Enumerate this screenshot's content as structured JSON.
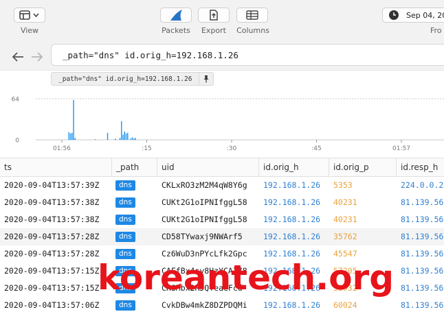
{
  "toolbar": {
    "view_label": "View",
    "packets_label": "Packets",
    "export_label": "Export",
    "columns_label": "Columns",
    "date_text": "Sep 04, 20",
    "from_label": "Fro"
  },
  "search": {
    "query": "_path=\"dns\" id.orig_h=192.168.1.26",
    "pill_text": "_path=\"dns\" id.orig_h=192.168.1.26"
  },
  "chart_data": {
    "type": "bar",
    "ylim": [
      0,
      64
    ],
    "y_ticks": [
      "64",
      "0"
    ],
    "x_ticks": [
      "01:56",
      ":15",
      ":30",
      ":45",
      "01:57"
    ],
    "values": [
      0,
      0,
      0,
      0,
      0,
      0,
      0,
      0,
      0,
      0,
      0,
      0,
      0,
      0,
      0,
      0,
      0,
      0,
      0,
      0,
      0,
      12,
      10,
      11,
      62,
      3,
      0,
      0,
      0,
      0,
      0,
      0,
      0,
      0,
      0,
      0,
      0,
      0,
      1,
      0,
      0,
      0,
      0,
      0,
      0,
      0,
      11,
      0,
      0,
      0,
      0,
      2,
      0,
      0,
      3,
      29,
      8,
      13,
      10,
      11,
      0,
      2,
      4,
      2,
      3,
      0,
      0,
      0,
      0,
      0,
      0,
      0,
      0,
      0,
      0,
      0,
      0,
      0,
      0,
      0,
      0,
      0,
      0,
      0,
      0,
      0,
      0,
      0,
      0,
      0,
      0,
      0,
      0,
      0,
      0,
      0,
      0,
      0,
      0,
      0,
      0,
      0,
      0,
      0,
      0,
      0,
      0,
      0,
      0,
      0,
      0,
      0,
      0,
      0,
      0,
      0,
      0,
      0,
      0,
      0,
      0,
      0,
      0,
      0,
      0,
      0,
      0,
      0,
      0,
      0,
      0,
      0,
      0,
      0,
      0,
      0,
      0,
      0,
      0,
      0,
      0,
      0,
      0,
      0,
      0,
      0,
      0,
      0,
      0,
      0,
      0,
      0,
      0,
      0,
      0,
      0,
      0,
      0,
      0,
      0,
      0,
      0,
      0,
      0,
      0,
      0,
      0,
      0,
      0,
      0,
      0,
      0,
      0,
      0,
      0,
      0,
      0,
      0,
      0,
      0,
      0,
      0,
      0,
      0,
      0,
      0,
      0,
      0,
      0,
      0,
      0,
      0,
      0,
      0,
      0,
      0,
      0,
      0,
      0,
      0,
      0,
      0,
      0,
      0,
      0,
      0,
      0,
      0,
      0,
      0,
      0,
      0,
      0,
      0,
      0,
      0,
      0,
      0,
      0,
      0,
      0,
      0,
      0,
      0,
      0,
      0,
      0,
      0,
      0,
      0,
      0,
      0,
      0,
      0,
      0,
      0,
      0,
      0,
      0,
      0,
      0,
      0,
      0,
      0,
      0,
      0,
      0,
      0,
      0,
      0,
      0,
      0,
      0,
      0,
      0,
      0,
      0,
      0,
      0,
      0,
      0,
      0,
      0,
      0
    ],
    "colors": {
      "bar": "#2196f3"
    }
  },
  "table": {
    "columns": [
      "ts",
      "_path",
      "uid",
      "id.orig_h",
      "id.orig_p",
      "id.resp_h"
    ],
    "rows": [
      {
        "ts": "2020-09-04T13:57:39Z",
        "path": "dns",
        "uid": "CKLxRO3zM2M4qW8Y6g",
        "orig_h": "192.168.1.26",
        "orig_p": "5353",
        "resp_h": "224.0.0.2"
      },
      {
        "ts": "2020-09-04T13:57:38Z",
        "path": "dns",
        "uid": "CUKt2G1oIPNIfggL58",
        "orig_h": "192.168.1.26",
        "orig_p": "40231",
        "resp_h": "81.139.56"
      },
      {
        "ts": "2020-09-04T13:57:38Z",
        "path": "dns",
        "uid": "CUKt2G1oIPNIfggL58",
        "orig_h": "192.168.1.26",
        "orig_p": "40231",
        "resp_h": "81.139.56"
      },
      {
        "ts": "2020-09-04T13:57:28Z",
        "path": "dns",
        "uid": "CD58TYwaxj9NWArf5",
        "orig_h": "192.168.1.26",
        "orig_p": "35762",
        "resp_h": "81.139.56"
      },
      {
        "ts": "2020-09-04T13:57:28Z",
        "path": "dns",
        "uid": "Cz6WuD3nPYcLfk2Gpc",
        "orig_h": "192.168.1.26",
        "orig_p": "45547",
        "resp_h": "81.139.56"
      },
      {
        "ts": "2020-09-04T13:57:15Z",
        "path": "dns",
        "uid": "CAFfBx4sy8HzYCAZ78",
        "orig_h": "192.168.1.26",
        "orig_p": "57205",
        "resp_h": "81.139.56"
      },
      {
        "ts": "2020-09-04T13:57:15Z",
        "path": "dns",
        "uid": "CHSMbx2RJQTeaeFcd",
        "orig_h": "192.168.1.26",
        "orig_p": "33032",
        "resp_h": "81.139.56"
      },
      {
        "ts": "2020-09-04T13:57:06Z",
        "path": "dns",
        "uid": "CvkDBw4mkZ8DZPDQMi",
        "orig_h": "192.168.1.26",
        "orig_p": "60024",
        "resp_h": "81.139.56"
      }
    ]
  },
  "watermark": "koreantech.org",
  "colors": {
    "ip": "#2f80d1",
    "port": "#e8a33d",
    "badge": "#1e88e5",
    "watermark": "#e8141b"
  }
}
